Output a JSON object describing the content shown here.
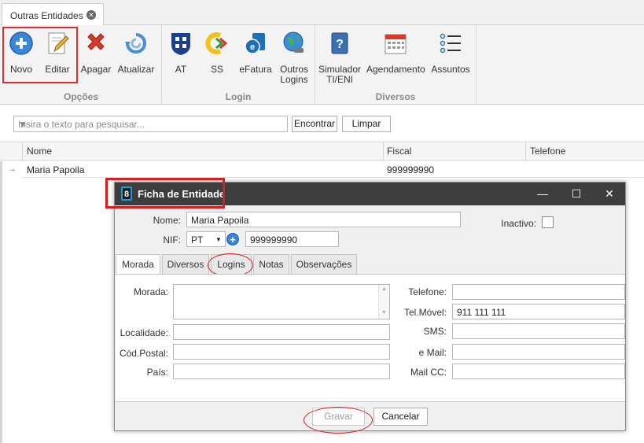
{
  "tab": {
    "label": "Outras Entidades"
  },
  "ribbon": {
    "buttons": [
      {
        "label": "Novo"
      },
      {
        "label": "Editar"
      },
      {
        "label": "Apagar"
      },
      {
        "label": "Atualizar"
      },
      {
        "label": "AT"
      },
      {
        "label": "SS"
      },
      {
        "label": "eFatura"
      },
      {
        "label": "Outros Logins"
      },
      {
        "label": "Simulador TI/ENI"
      },
      {
        "label": "Agendamento"
      },
      {
        "label": "Assuntos"
      }
    ],
    "groups": {
      "opcoes": "Opções",
      "login": "Login",
      "diversos": "Diversos"
    }
  },
  "search": {
    "placeholder": "Insira o texto para pesquisar...",
    "find_label": "Encontrar",
    "clear_label": "Limpar"
  },
  "grid": {
    "columns": [
      "Nome",
      "Fiscal",
      "Telefone"
    ],
    "rows": [
      {
        "nome": "Maria Papoila",
        "fiscal": "999999990",
        "telefone": ""
      }
    ]
  },
  "dialog": {
    "title": "Ficha de Entidade",
    "nome_label": "Nome:",
    "nome_value": "Maria Papoila",
    "inactivo_label": "Inactivo:",
    "nif_label": "NIF:",
    "nif_country": "PT",
    "nif_value": "999999990",
    "tabs": [
      "Morada",
      "Diversos",
      "Logins",
      "Notas",
      "Observações"
    ],
    "fields_left": {
      "morada": "Morada:",
      "localidade": "Localidade:",
      "cod_postal": "Cód.Postal:",
      "pais": "País:"
    },
    "fields_right": {
      "telefone": "Telefone:",
      "tel_movel": "Tel.Móvel:",
      "tel_movel_value": "911 111 111",
      "sms": "SMS:",
      "email": "e Mail:",
      "mail_cc": "Mail CC:"
    },
    "save_label": "Gravar",
    "cancel_label": "Cancelar"
  },
  "colors": {
    "highlight": "#d21f1f",
    "title_bar": "#3d3d3d",
    "accent": "#1e9ad6"
  }
}
